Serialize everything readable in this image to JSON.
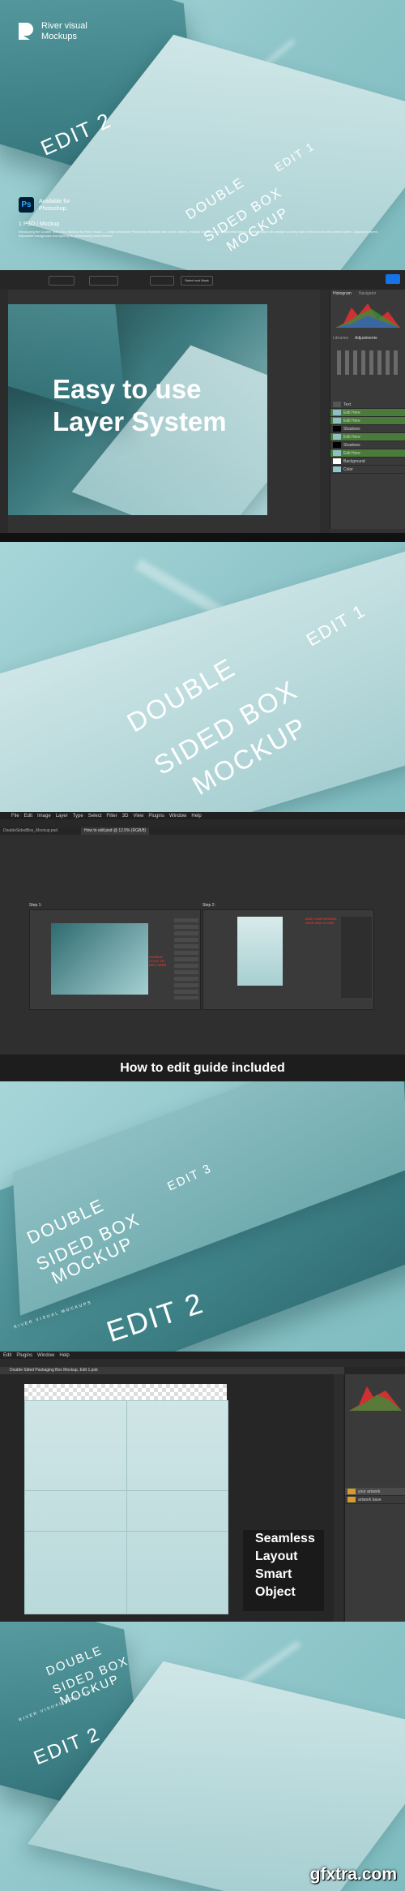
{
  "hero": {
    "brand_line1": "River visual",
    "brand_line2": "Mockups",
    "ps_badge": "Ps",
    "available_line1": "Available for",
    "available_line2": "Photoshop.",
    "file_info": "1 PSD | Mockup",
    "fine_print": "Introducing the Double Sided Box Mockup by River Visual — a high-resolution Photoshop template with smart objects, realistic shadows and a seamless layout. Easily replace the design on every side of the box and the printed sheet. Organized layers, adjustable background and lighting for professional presentations.",
    "box_edit": "EDIT 2",
    "sheet_title": [
      "DOUBLE",
      "SIDED BOX",
      "MOCKUP"
    ],
    "sheet_edit": "EDIT 1"
  },
  "layers_section": {
    "headline_line1": "Easy to use",
    "headline_line2": "Layer System",
    "toolbar_buttons": [
      "",
      "",
      "",
      "Select and Mask"
    ],
    "panel_tabs": [
      "Histogram",
      "Navigator"
    ],
    "adjust_tabs": [
      "Libraries",
      "Adjustments"
    ],
    "layer_names": [
      "Text",
      "Edit Here",
      "Edit Here",
      "Shadows",
      "Edit Here",
      "Shadows",
      "Edit Here",
      "Background",
      "Color"
    ]
  },
  "closeup": {
    "sheet_title": [
      "DOUBLE",
      "SIDED BOX",
      "MOCKUP"
    ],
    "edit": "EDIT 1"
  },
  "guide": {
    "menu": [
      "File",
      "Edit",
      "Image",
      "Layer",
      "Type",
      "Select",
      "Filter",
      "3D",
      "View",
      "Plugins",
      "Window",
      "Help"
    ],
    "tab_active": "How to edit.psd @ 12.5% (RGB/8)",
    "tab_other": "DoubleSidedBox_Mockup.psd",
    "step1": "Step 1:",
    "step2": "Step 2:",
    "step1_note": "DOUBLE CLICK TO EDIT HERE",
    "step2_note": "ADD YOUR DESIGN, SAVE AND CLOSE",
    "caption": "How to edit guide included"
  },
  "box_shot": {
    "lid_title": [
      "DOUBLE",
      "SIDED BOX",
      "MOCKUP"
    ],
    "lid_edit": "EDIT 3",
    "side_edit": "EDIT 2",
    "side_small": "RIVER VISUAL MOCKUPS"
  },
  "smart_object": {
    "menu": [
      "Edit",
      "Plugins",
      "Window",
      "Help"
    ],
    "tab_title": "Double Sided Packaging Box Mockup, Edit 1.psb",
    "layer_names": [
      "your artwork",
      "artwork base"
    ],
    "caption_lines": [
      "Seamless",
      "Layout",
      "Smart",
      "Object"
    ]
  },
  "final": {
    "lid_title": [
      "DOUBLE",
      "SIDED BOX",
      "MOCKUP"
    ],
    "box_edit": "EDIT 2",
    "side_small": "RIVER VISUAL MOCKUPS",
    "watermark": "gfxtra.com"
  },
  "colors": {
    "teal": "#8fc8cc",
    "box": "#3f8389",
    "ps_bg": "#323232",
    "ps_panel": "#3a3a3a",
    "red_note": "#e0302a",
    "ps_blue": "#31a8ff"
  }
}
